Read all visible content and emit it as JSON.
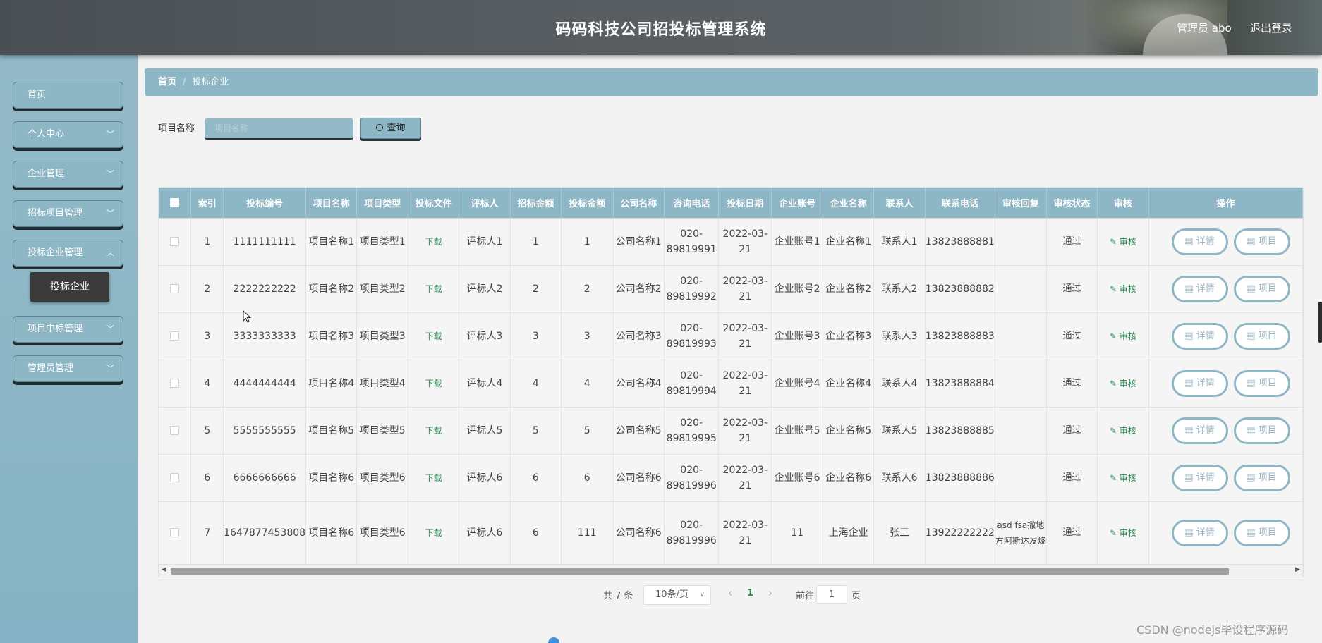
{
  "header": {
    "title": "码码科技公司招投标管理系统",
    "user": "管理员 abo",
    "logout": "退出登录"
  },
  "sidebar": {
    "items": [
      {
        "label": "首页",
        "has_children": false
      },
      {
        "label": "个人中心",
        "has_children": true
      },
      {
        "label": "企业管理",
        "has_children": true
      },
      {
        "label": "招标项目管理",
        "has_children": true
      },
      {
        "label": "投标企业管理",
        "has_children": true,
        "expanded": true
      },
      {
        "label": "项目中标管理",
        "has_children": true
      },
      {
        "label": "管理员管理",
        "has_children": true
      }
    ],
    "active_sub": "投标企业"
  },
  "breadcrumb": {
    "home": "首页",
    "separator": "/",
    "current": "投标企业"
  },
  "search": {
    "label": "项目名称",
    "placeholder": "项目名称",
    "button": "查询"
  },
  "table": {
    "columns": [
      "索引",
      "投标编号",
      "项目名称",
      "项目类型",
      "投标文件",
      "评标人",
      "招标金额",
      "投标金额",
      "公司名称",
      "咨询电话",
      "投标日期",
      "企业账号",
      "企业名称",
      "联系人",
      "联系电话",
      "审核回复",
      "审核状态",
      "审核",
      "操作"
    ],
    "rows": [
      {
        "idx": "1",
        "bid_no": "1111111111",
        "project": "项目名称1",
        "type": "项目类型1",
        "file": "下载",
        "judge": "评标人1",
        "tender_amount": "1",
        "bid_amount": "1",
        "company": "公司名称1",
        "phone": "020-89819991",
        "date": "2022-03-21",
        "account": "企业账号1",
        "ent_name": "企业名称1",
        "contact": "联系人1",
        "contact_phone": "13823888881",
        "reply": "",
        "status": "通过",
        "audit": "审核",
        "detail": "详情",
        "op2": "项目"
      },
      {
        "idx": "2",
        "bid_no": "2222222222",
        "project": "项目名称2",
        "type": "项目类型2",
        "file": "下载",
        "judge": "评标人2",
        "tender_amount": "2",
        "bid_amount": "2",
        "company": "公司名称2",
        "phone": "020-89819992",
        "date": "2022-03-21",
        "account": "企业账号2",
        "ent_name": "企业名称2",
        "contact": "联系人2",
        "contact_phone": "13823888882",
        "reply": "",
        "status": "通过",
        "audit": "审核",
        "detail": "详情",
        "op2": "项目"
      },
      {
        "idx": "3",
        "bid_no": "3333333333",
        "project": "项目名称3",
        "type": "项目类型3",
        "file": "下载",
        "judge": "评标人3",
        "tender_amount": "3",
        "bid_amount": "3",
        "company": "公司名称3",
        "phone": "020-89819993",
        "date": "2022-03-21",
        "account": "企业账号3",
        "ent_name": "企业名称3",
        "contact": "联系人3",
        "contact_phone": "13823888883",
        "reply": "",
        "status": "通过",
        "audit": "审核",
        "detail": "详情",
        "op2": "项目"
      },
      {
        "idx": "4",
        "bid_no": "4444444444",
        "project": "项目名称4",
        "type": "项目类型4",
        "file": "下载",
        "judge": "评标人4",
        "tender_amount": "4",
        "bid_amount": "4",
        "company": "公司名称4",
        "phone": "020-89819994",
        "date": "2022-03-21",
        "account": "企业账号4",
        "ent_name": "企业名称4",
        "contact": "联系人4",
        "contact_phone": "13823888884",
        "reply": "",
        "status": "通过",
        "audit": "审核",
        "detail": "详情",
        "op2": "项目"
      },
      {
        "idx": "5",
        "bid_no": "5555555555",
        "project": "项目名称5",
        "type": "项目类型5",
        "file": "下载",
        "judge": "评标人5",
        "tender_amount": "5",
        "bid_amount": "5",
        "company": "公司名称5",
        "phone": "020-89819995",
        "date": "2022-03-21",
        "account": "企业账号5",
        "ent_name": "企业名称5",
        "contact": "联系人5",
        "contact_phone": "13823888885",
        "reply": "",
        "status": "通过",
        "audit": "审核",
        "detail": "详情",
        "op2": "项目"
      },
      {
        "idx": "6",
        "bid_no": "6666666666",
        "project": "项目名称6",
        "type": "项目类型6",
        "file": "下载",
        "judge": "评标人6",
        "tender_amount": "6",
        "bid_amount": "6",
        "company": "公司名称6",
        "phone": "020-89819996",
        "date": "2022-03-21",
        "account": "企业账号6",
        "ent_name": "企业名称6",
        "contact": "联系人6",
        "contact_phone": "13823888886",
        "reply": "",
        "status": "通过",
        "audit": "审核",
        "detail": "详情",
        "op2": "项目"
      },
      {
        "idx": "7",
        "bid_no": "1647877453808",
        "project": "项目名称6",
        "type": "项目类型6",
        "file": "下载",
        "judge": "评标人6",
        "tender_amount": "6",
        "bid_amount": "111",
        "company": "公司名称6",
        "phone": "020-89819996",
        "date": "2022-03-21",
        "account": "11",
        "ent_name": "上海企业",
        "contact": "张三",
        "contact_phone": "13922222222",
        "reply": "asd fsa撒地方阿斯达发烧",
        "status": "通过",
        "audit": "审核",
        "detail": "详情",
        "op2": "项目"
      }
    ]
  },
  "pagination": {
    "total": "共 7 条",
    "page_size": "10条/页",
    "current_page": "1",
    "goto_label": "前往",
    "goto_value": "1",
    "page_suffix": "页"
  },
  "watermark": "CSDN @nodejs毕设程序源码",
  "colors": {
    "primary": "#8eb7c6",
    "accent_green": "#2c8a57",
    "header_bg": "#565c60"
  }
}
